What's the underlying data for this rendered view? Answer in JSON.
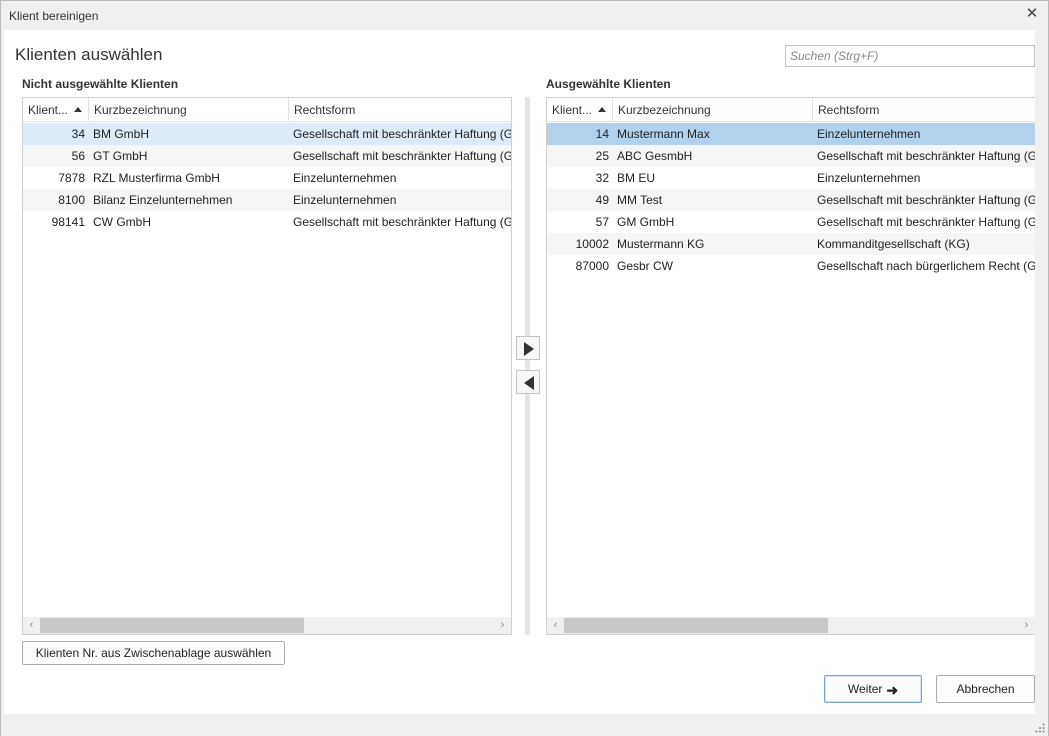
{
  "window": {
    "title": "Klient bereinigen",
    "close_glyph": "✕"
  },
  "heading": "Klienten auswählen",
  "search": {
    "placeholder": "Suchen (Strg+F)",
    "value": ""
  },
  "left_panel": {
    "label": "Nicht ausgewählte Klienten",
    "columns": [
      "Klient...",
      "Kurzbezeichnung",
      "Rechtsform"
    ],
    "rows": [
      {
        "nr": "34",
        "name": "BM GmbH",
        "form": "Gesellschaft mit beschränkter Haftung (G"
      },
      {
        "nr": "56",
        "name": "GT GmbH",
        "form": "Gesellschaft mit beschränkter Haftung (G"
      },
      {
        "nr": "7878",
        "name": "RZL Musterfirma GmbH",
        "form": "Einzelunternehmen"
      },
      {
        "nr": "8100",
        "name": "Bilanz Einzelunternehmen",
        "form": "Einzelunternehmen"
      },
      {
        "nr": "98141",
        "name": "CW GmbH",
        "form": "Gesellschaft mit beschränkter Haftung (G"
      }
    ],
    "selected_row": 0
  },
  "right_panel": {
    "label": "Ausgewählte Klienten",
    "columns": [
      "Klient...",
      "Kurzbezeichnung",
      "Rechtsform"
    ],
    "rows": [
      {
        "nr": "14",
        "name": "Mustermann Max",
        "form": "Einzelunternehmen"
      },
      {
        "nr": "25",
        "name": "ABC GesmbH",
        "form": "Gesellschaft mit beschränkter Haftung (G"
      },
      {
        "nr": "32",
        "name": "BM EU",
        "form": "Einzelunternehmen"
      },
      {
        "nr": "49",
        "name": "MM Test",
        "form": "Gesellschaft mit beschränkter Haftung (G"
      },
      {
        "nr": "57",
        "name": "GM GmbH",
        "form": "Gesellschaft mit beschränkter Haftung (G"
      },
      {
        "nr": "10002",
        "name": "Mustermann KG",
        "form": "Kommanditgesellschaft (KG)"
      },
      {
        "nr": "87000",
        "name": "Gesbr CW",
        "form": "Gesellschaft nach bürgerlichem Recht (Ge"
      }
    ],
    "selected_row": 0
  },
  "buttons": {
    "clipboard": "Klienten Nr. aus Zwischenablage auswählen",
    "next": "Weiter",
    "cancel": "Abbrechen"
  },
  "icons": {
    "move_right": "triangle-right-icon",
    "move_left": "triangle-left-icon",
    "next_arrow": "arrow-right-icon",
    "sort": "sort-ascending-icon"
  },
  "colors": {
    "selection_light": "#dcebf7",
    "selection_strong": "#b1d1ec",
    "alt_row": "#f5f5f5"
  }
}
